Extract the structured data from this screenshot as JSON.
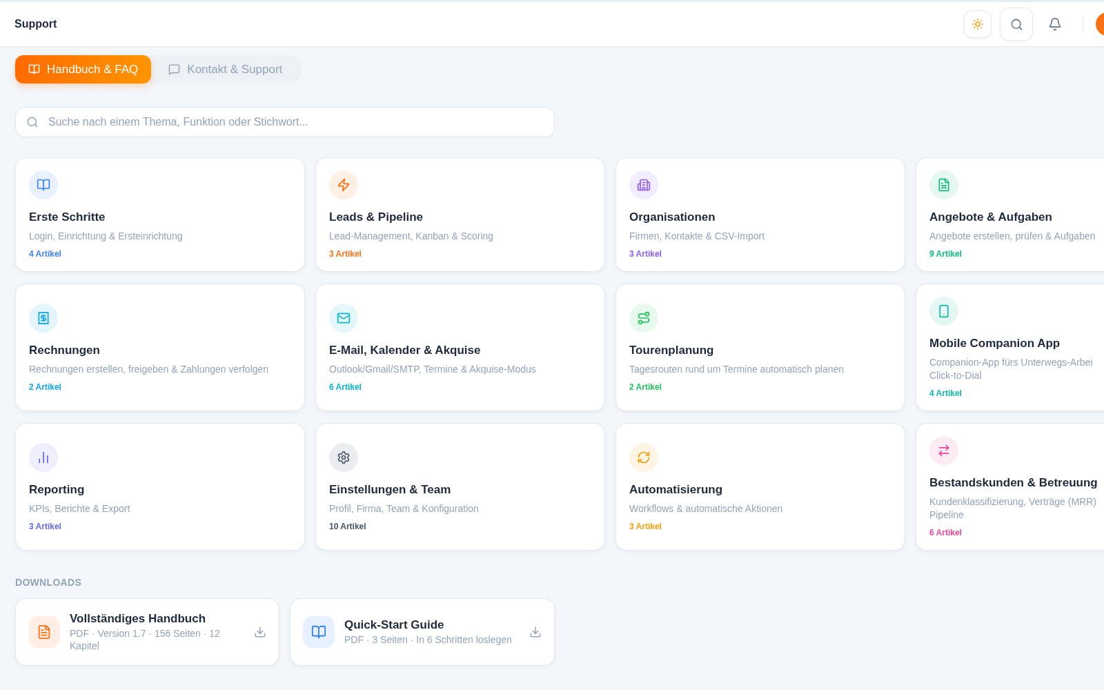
{
  "header": {
    "title": "Support"
  },
  "tabs": [
    {
      "label": "Handbuch & FAQ",
      "selected": true
    },
    {
      "label": "Kontakt & Support",
      "selected": false
    }
  ],
  "search": {
    "placeholder": "Suche nach einem Thema, Funktion oder Stichwort..."
  },
  "categories": [
    {
      "title": "Erste Schritte",
      "description": "Login, Einrichtung & Ersteinrichtung",
      "count": "4 Artikel",
      "color": "#3b82f6"
    },
    {
      "title": "Leads & Pipeline",
      "description": "Lead-Management, Kanban & Scoring",
      "count": "3 Artikel",
      "color": "#f97316"
    },
    {
      "title": "Organisationen",
      "description": "Firmen, Kontakte & CSV-Import",
      "count": "3 Artikel",
      "color": "#8b5cf6"
    },
    {
      "title": "Angebote & Aufgaben",
      "description": "Angebote erstellen, prüfen & Aufgaben",
      "count": "9 Artikel",
      "color": "#10b981"
    },
    {
      "title": "Rechnungen",
      "description": "Rechnungen erstellen, freigeben & Zahlungen verfolgen",
      "count": "2 Artikel",
      "color": "#0ea5e9"
    },
    {
      "title": "E-Mail, Kalender & Akquise",
      "description": "Outlook/Gmail/SMTP, Termine & Akquise-Modus",
      "count": "6 Artikel",
      "color": "#06b6d4"
    },
    {
      "title": "Tourenplanung",
      "description": "Tagesrouten rund um Termine automatisch planen",
      "count": "2 Artikel",
      "color": "#22c55e"
    },
    {
      "title": "Mobile Companion App",
      "description": "Companion-App fürs Unterwegs-Arbei\nClick-to-Dial",
      "count": "4 Artikel",
      "color": "#14b8a6"
    },
    {
      "title": "Reporting",
      "description": "KPIs, Berichte & Export",
      "count": "3 Artikel",
      "color": "#6366f1"
    },
    {
      "title": "Einstellungen & Team",
      "description": "Profil, Firma, Team & Konfiguration",
      "count": "10 Artikel",
      "color": "#475569"
    },
    {
      "title": "Automatisierung",
      "description": "Workflows & automatische Aktionen",
      "count": "3 Artikel",
      "color": "#f59e0b"
    },
    {
      "title": "Bestandskunden & Betreuung",
      "description": "Kundenklassifizierung, Verträge (MRR)\nPipeline",
      "count": "6 Artikel",
      "color": "#ec4899"
    }
  ],
  "downloads": {
    "heading": "DOWNLOADS",
    "items": [
      {
        "title": "Vollständiges Handbuch",
        "meta": "PDF · Version 1.7 · 156 Seiten · 12 Kapitel",
        "color": "#f97316"
      },
      {
        "title": "Quick-Start Guide",
        "meta": "PDF · 3 Seiten · In 6 Schritten loslegen",
        "color": "#3b82f6"
      }
    ]
  }
}
